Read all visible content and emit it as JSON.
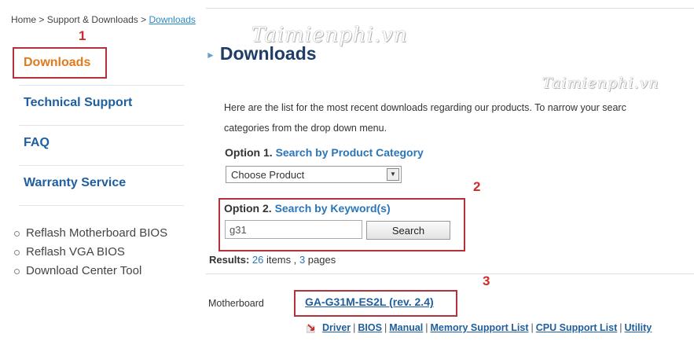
{
  "breadcrumb": {
    "home": "Home",
    "support": "Support & Downloads",
    "current": "Downloads",
    "sep": ">"
  },
  "watermark": {
    "text": "Taimienphi.vn"
  },
  "annotations": {
    "a1": "1",
    "a2": "2",
    "a3": "3"
  },
  "sidebar": {
    "items": [
      {
        "label": "Downloads",
        "active": true
      },
      {
        "label": "Technical Support"
      },
      {
        "label": "FAQ"
      },
      {
        "label": "Warranty Service"
      }
    ],
    "links": [
      "Reflash Motherboard BIOS",
      "Reflash VGA BIOS",
      "Download Center Tool"
    ]
  },
  "main": {
    "title": "Downloads",
    "intro_line1": "Here are the list for the most recent downloads regarding our products. To narrow your searc",
    "intro_line2": "categories from the drop down menu.",
    "option1": {
      "label": "Option 1.",
      "sub": "Search by Product Category",
      "selected": "Choose Product"
    },
    "option2": {
      "label": "Option 2.",
      "sub": "Search by Keyword(s)",
      "value": "g31",
      "button": "Search"
    },
    "results": {
      "label": "Results:",
      "items": "26",
      "items_label": "items ,",
      "pages": "3",
      "pages_label": "pages"
    },
    "product": {
      "category": "Motherboard",
      "name": "GA-G31M-ES2L (rev. 2.4)",
      "links": [
        "Driver",
        "BIOS",
        "Manual",
        "Memory Support List",
        "CPU Support List",
        "Utility"
      ]
    }
  },
  "colors": {
    "accent": "#1f5fa0",
    "active": "#e07a1e",
    "annotation": "#b3313a"
  }
}
